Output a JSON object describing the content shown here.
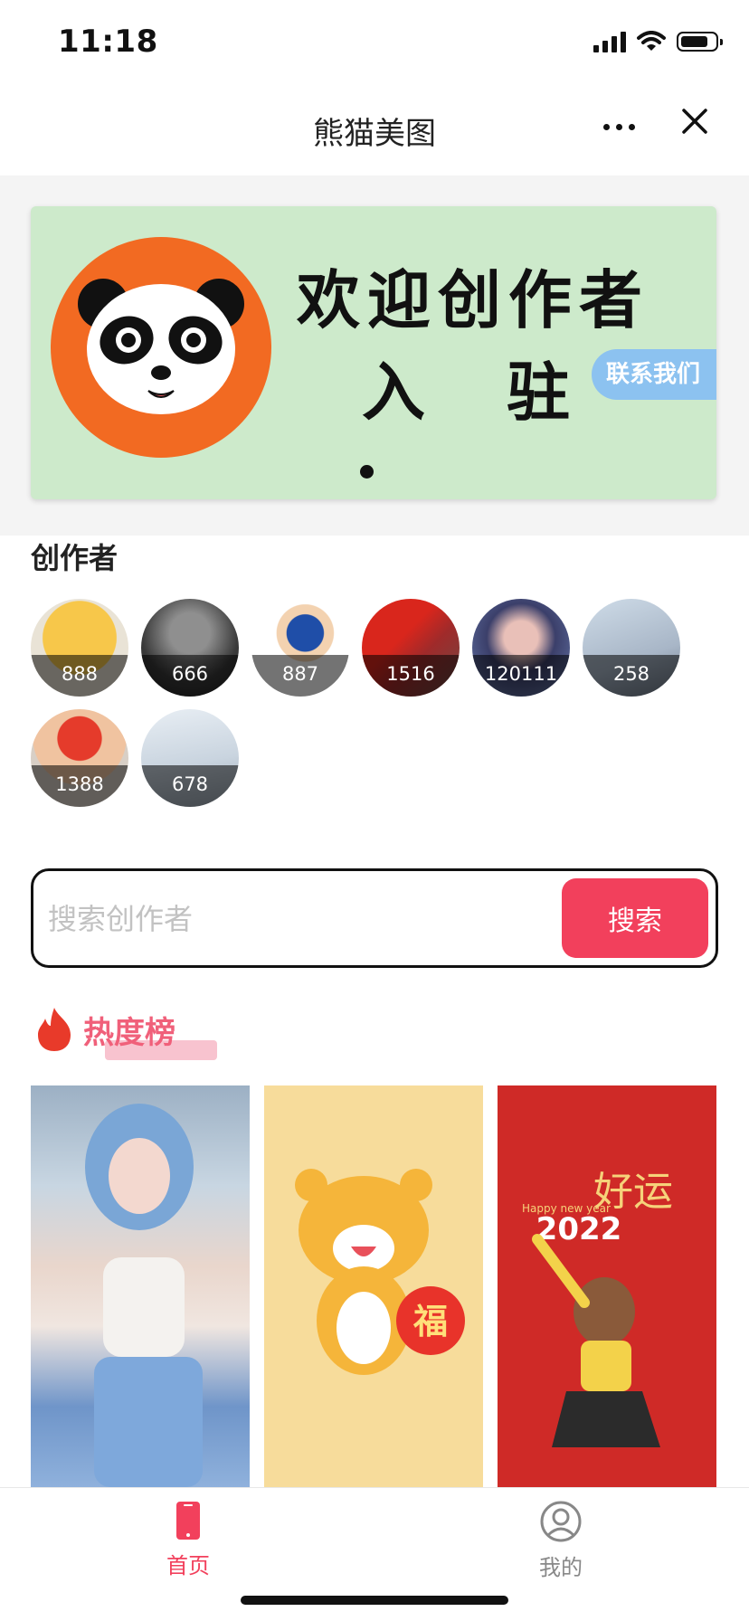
{
  "status_bar": {
    "time": "11:18"
  },
  "nav": {
    "title": "熊猫美图"
  },
  "banner": {
    "line1": "欢迎创作者",
    "line2": "入驻",
    "contact": "联系我们"
  },
  "creators_section": {
    "title": "创作者",
    "items": [
      {
        "count": "888"
      },
      {
        "count": "666"
      },
      {
        "count": "887"
      },
      {
        "count": "1516"
      },
      {
        "count": "120111"
      },
      {
        "count": "258"
      },
      {
        "count": "1388"
      },
      {
        "count": "678"
      }
    ]
  },
  "search": {
    "placeholder": "搜索创作者",
    "button_label": "搜索"
  },
  "hot": {
    "title": "热度榜"
  },
  "thumbs": [
    {
      "text": ""
    },
    {
      "text": "福"
    },
    {
      "text": "好运",
      "text2": "2022",
      "text3": "Happy new year"
    }
  ],
  "tabs": [
    {
      "label": "首页"
    },
    {
      "label": "我的"
    }
  ],
  "colors": {
    "accent": "#f2405c",
    "banner_bg": "#cdeacb",
    "panda_orange": "#f26a22"
  }
}
